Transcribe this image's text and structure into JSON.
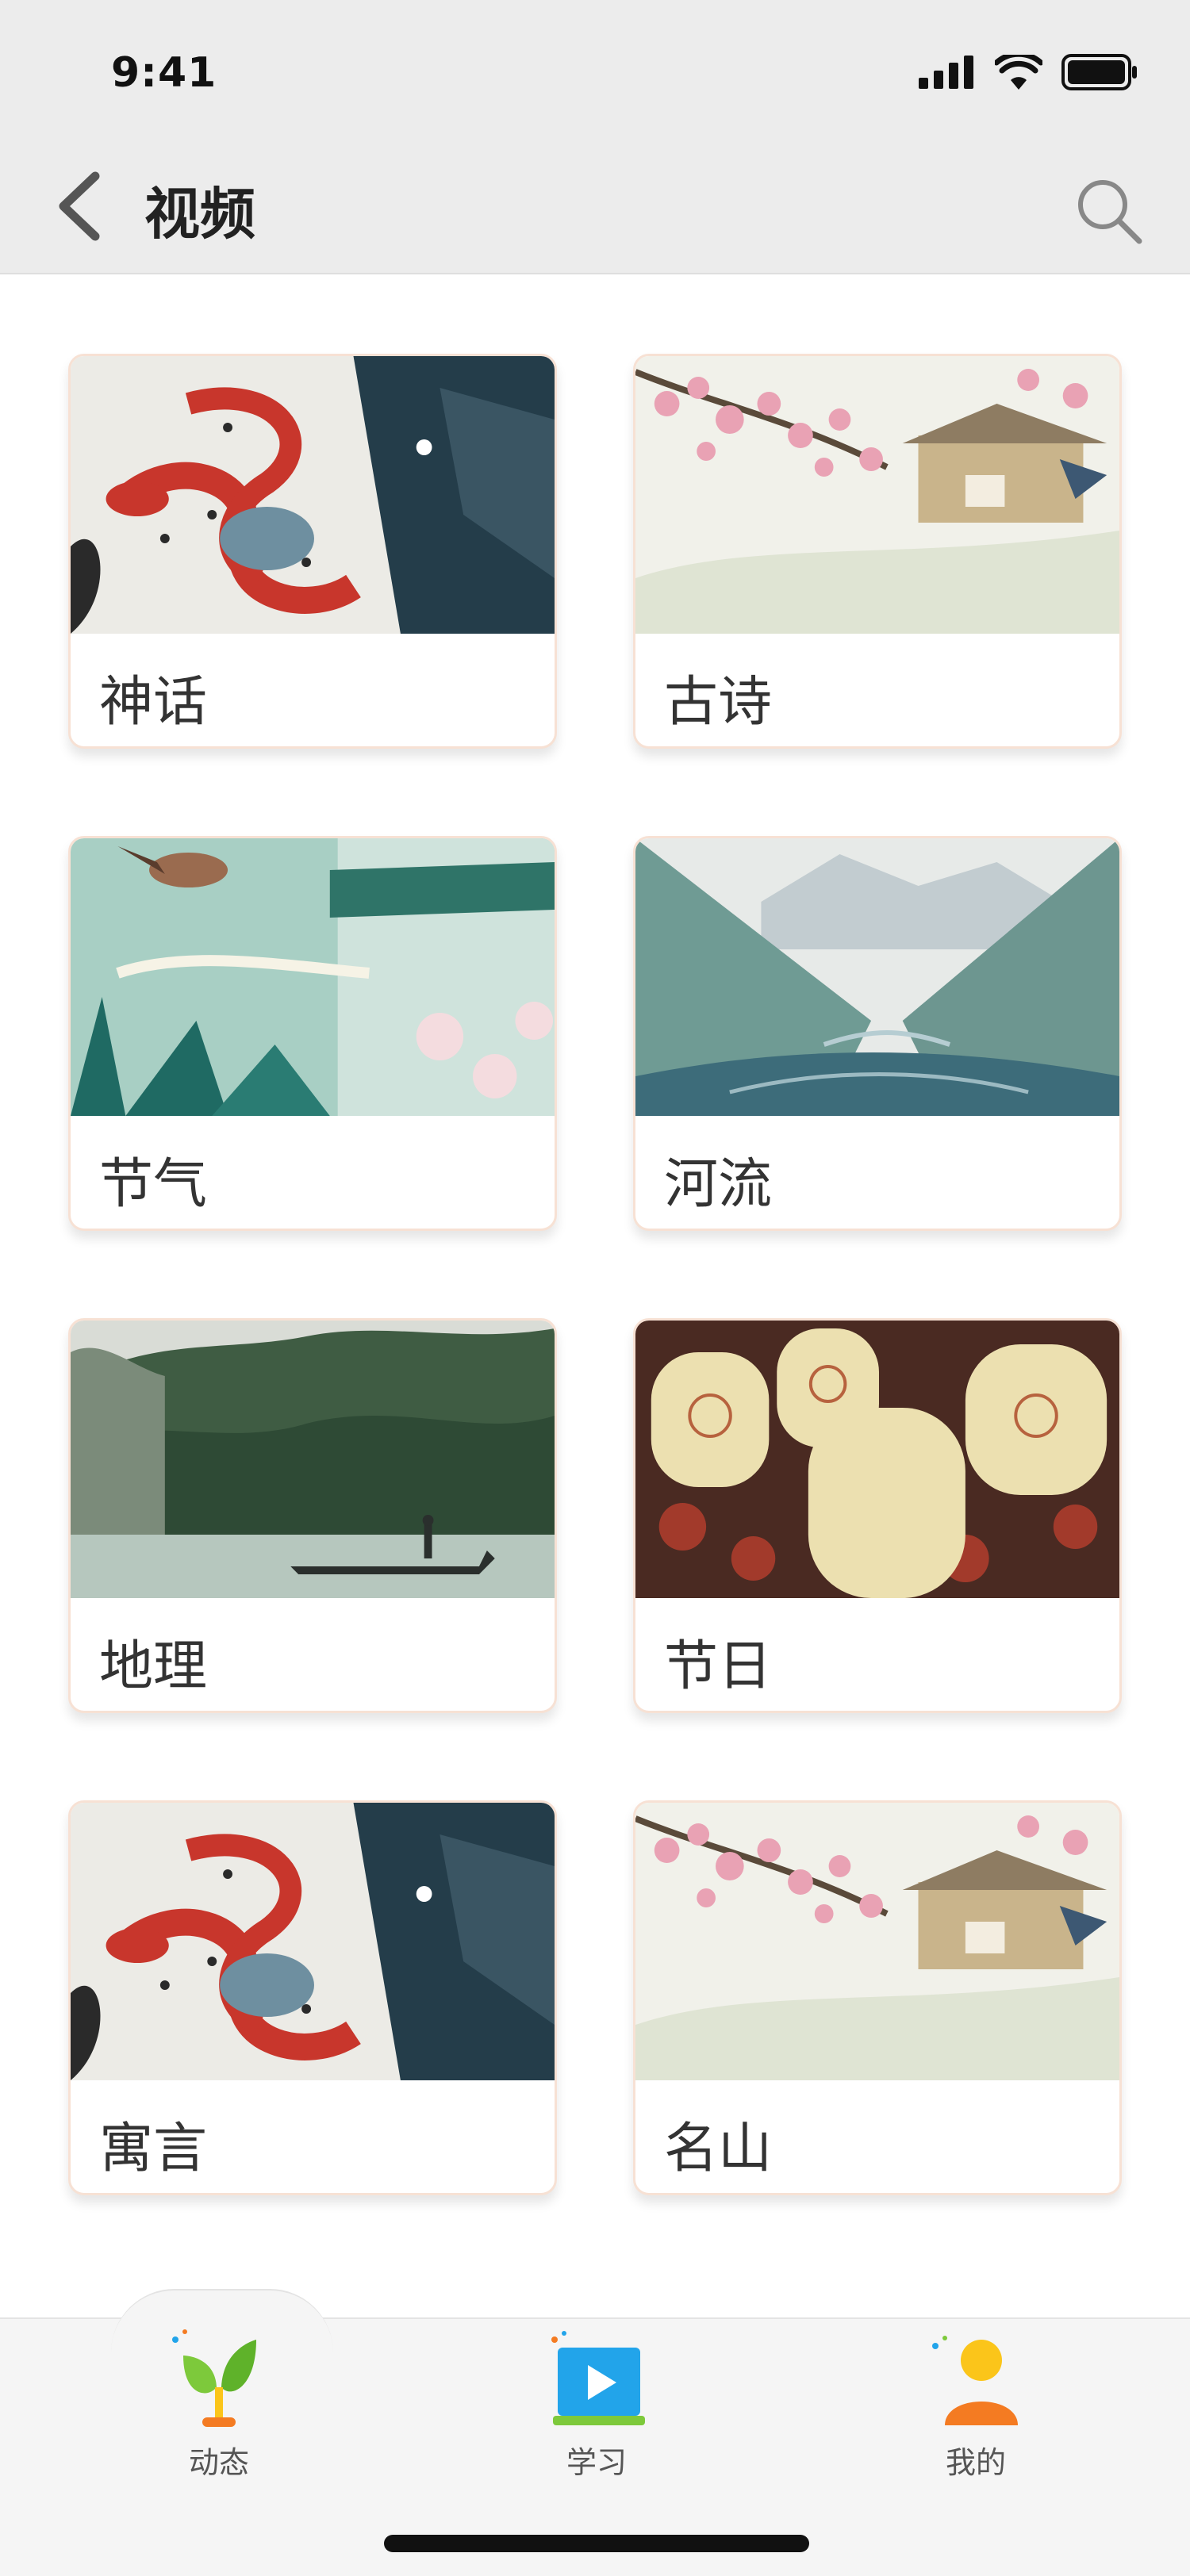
{
  "status_bar": {
    "time": "9:41"
  },
  "header": {
    "title": "视频",
    "back_icon": "chevron-left-icon",
    "search_icon": "search-icon"
  },
  "cards": [
    {
      "label": "神话",
      "image": "serpent-illustration"
    },
    {
      "label": "古诗",
      "image": "blossom-pavilion-illustration"
    },
    {
      "label": "节气",
      "image": "bird-eaves-illustration"
    },
    {
      "label": "河流",
      "image": "river-valley-illustration"
    },
    {
      "label": "地理",
      "image": "boat-lake-illustration"
    },
    {
      "label": "节日",
      "image": "lanterns-illustration"
    },
    {
      "label": "寓言",
      "image": "serpent-illustration"
    },
    {
      "label": "名山",
      "image": "blossom-pavilion-illustration"
    }
  ],
  "tabbar": {
    "tabs": [
      {
        "label": "动态",
        "icon": "sprout-icon",
        "active": true
      },
      {
        "label": "学习",
        "icon": "play-screen-icon",
        "active": false
      },
      {
        "label": "我的",
        "icon": "person-icon",
        "active": false
      }
    ]
  },
  "colors": {
    "header_bg": "#ececec",
    "card_border": "#f7e1d4",
    "tab_green": "#7dc93b",
    "tab_blue": "#22a4ea",
    "tab_orange": "#f47b22",
    "tab_yellow": "#fbc51a"
  }
}
